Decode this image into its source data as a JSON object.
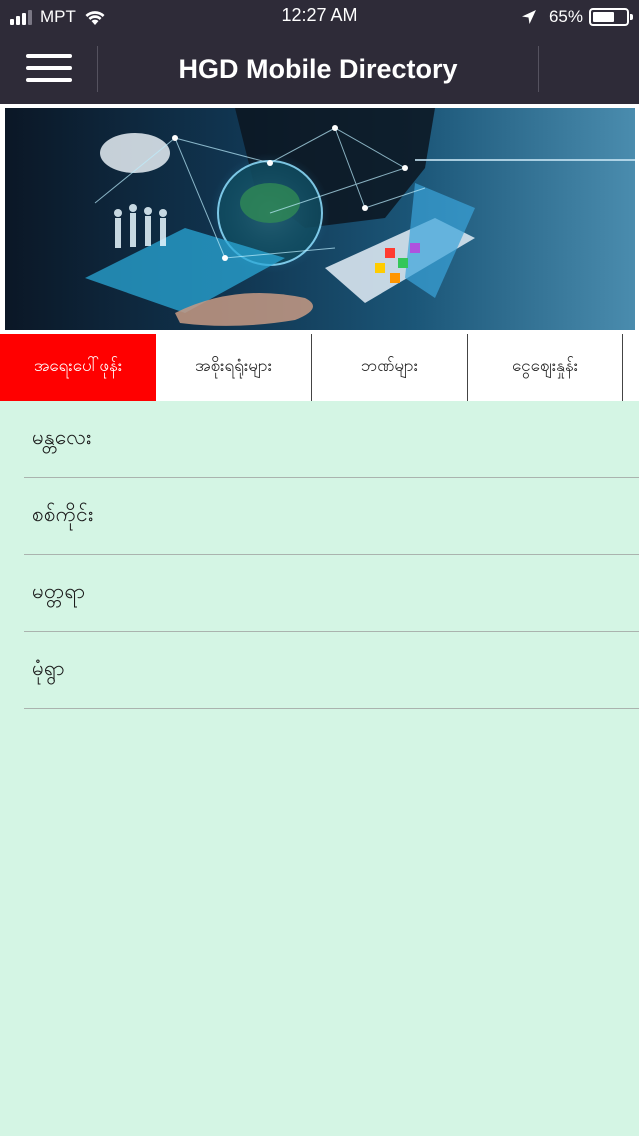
{
  "status_bar": {
    "carrier": "MPT",
    "time": "12:27 AM",
    "battery_percent": "65%",
    "battery_level": 0.65,
    "icons": [
      "signal-icon",
      "wifi-icon",
      "location-arrow-icon",
      "battery-icon"
    ]
  },
  "nav": {
    "title": "HGD Mobile Directory",
    "menu_icon": "hamburger-menu-icon"
  },
  "banner": {
    "image": "business-technology-network-banner"
  },
  "tabs": [
    {
      "label": "အရေးပေါ်ဖုန်း",
      "active": true
    },
    {
      "label": "အစိုးရရုံးများ",
      "active": false
    },
    {
      "label": "ဘဏ်များ",
      "active": false
    },
    {
      "label": "ငွေဈေးနှုန်း",
      "active": false
    }
  ],
  "list": [
    {
      "label": "မန္တလေး"
    },
    {
      "label": "စစ်ကိုင်း"
    },
    {
      "label": "မတ္တရာ"
    },
    {
      "label": "မုံရွာ"
    }
  ],
  "colors": {
    "header_bg": "#2e2b38",
    "active_tab": "#ff0000",
    "content_bg": "#d4f5e4"
  }
}
